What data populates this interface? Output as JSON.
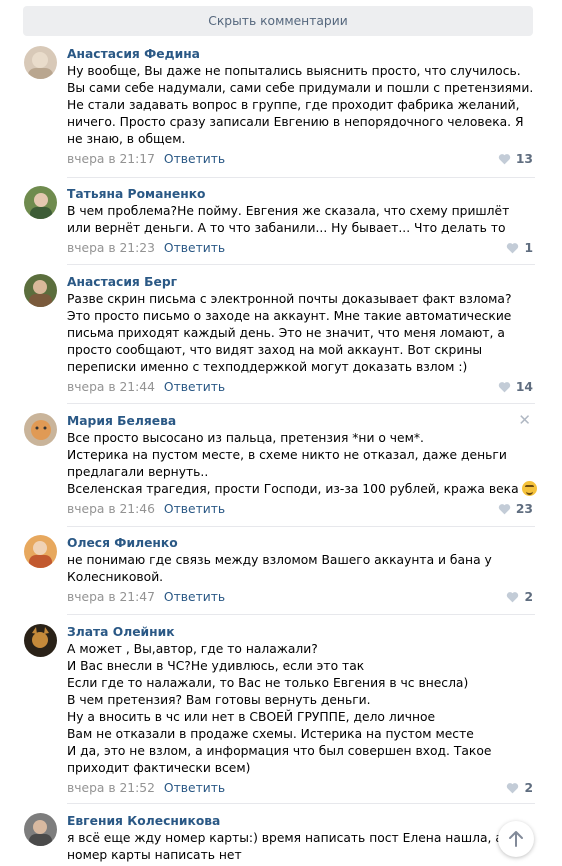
{
  "hide_comments_label": "Скрыть комментарии",
  "reply_label": "Ответить",
  "comments": [
    {
      "author": "Анастасия Федина",
      "text": "Ну вообще, Вы даже не попытались выяснить просто, что случилось. Вы сами себе надумали, сами себе придумали и пошли с претензиями. Не стали задавать вопрос в группе, где проходит фабрика желаний, ничего. Просто сразу записали Евгению в непорядочного человека. Я не знаю, в общем.",
      "date": "вчера в 21:17",
      "likes": "13"
    },
    {
      "author": "Татьяна Романенко",
      "text": "В чем проблема?Не пойму. Евгения же сказала, что схему пришлёт или вернёт деньги. А то что забанили... Ну бывает... Что делать то",
      "date": "вчера в 21:23",
      "likes": "1"
    },
    {
      "author": "Анастасия Берг",
      "text": "Разве скрин письма с электронной почты доказывает факт взлома? Это просто письмо о заходе на аккаунт. Мне такие автоматические письма приходят каждый день. Это не значит, что меня ломают, а просто сообщают, что видят заход на мой аккаунт. Вот скрины переписки именно с техподдержкой могут доказать взлом :)",
      "date": "вчера в 21:44",
      "likes": "14"
    },
    {
      "author": "Мария Беляева",
      "text": "Все просто высосано из пальца, претензия *ни о чем*.\nИстерика на пустом месте, в схеме никто не отказал, даже деньги предлагали вернуть..\nВселенская трагедия, прости Господи, из-за 100 рублей, кража века",
      "date": "вчера в 21:46",
      "likes": "23",
      "close_symbol": "✕"
    },
    {
      "author": "Олеся Филенко",
      "text": "не понимаю где связь между взломом Вашего аккаунта и бана у Колесниковой.",
      "date": "вчера в 21:47",
      "likes": "2"
    },
    {
      "author": "Злата Олейник",
      "text": "А может , Вы,автор, где то налажали?\nИ Вас внесли в ЧС?Не удивлюсь, если это так\nЕсли где то налажали, то Вас не только Евгения в чс внесла)\nВ чем претензия? Вам готовы вернуть деньги.\nНу а вносить в чс или нет в СВОЕЙ ГРУППЕ, дело личное\nВам не отказали в продаже схемы. Истерика на пустом месте\nИ да, это не взлом, а информация что был совершен вход. Такое приходит фактически всем)",
      "date": "вчера в 21:52",
      "likes": "2"
    },
    {
      "author": "Евгения Колесникова",
      "text": "я всё еще жду номер карты:) время написать пост Елена нашла, а номер карты написать нет",
      "date": "",
      "likes": ""
    }
  ],
  "colors": {
    "link": "#2a5885",
    "meta": "#939393",
    "button_bg": "#edeef0",
    "separator": "#e7e8ec"
  },
  "icons": [
    "heart-icon",
    "close-icon",
    "arrow-up-icon",
    "emoji-icon"
  ]
}
